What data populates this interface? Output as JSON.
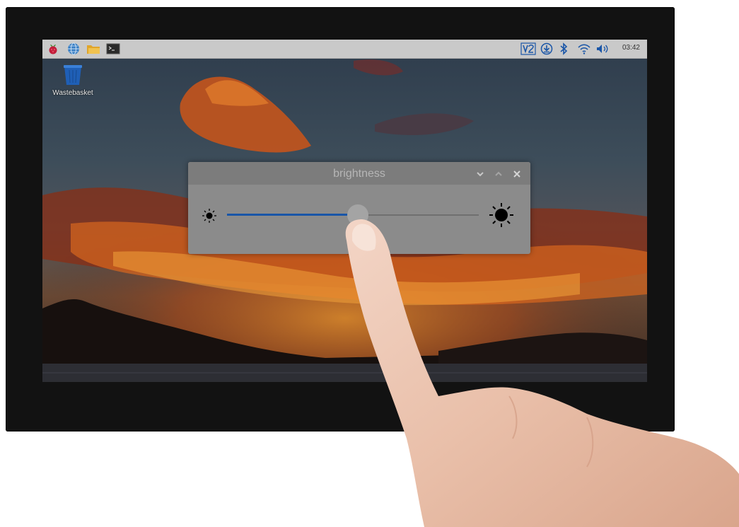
{
  "taskbar": {
    "launchers": [
      {
        "icon": "raspberry-menu-icon"
      },
      {
        "icon": "web-browser-globe-icon"
      },
      {
        "icon": "file-manager-folder-icon"
      },
      {
        "icon": "terminal-icon"
      }
    ],
    "tray": [
      {
        "icon": "vnc-icon"
      },
      {
        "icon": "download-update-icon"
      },
      {
        "icon": "bluetooth-icon"
      },
      {
        "icon": "wifi-icon"
      },
      {
        "icon": "volume-icon"
      }
    ],
    "clock": "03:42"
  },
  "desktop": {
    "icons": [
      {
        "label": "Wastebasket",
        "icon": "wastebasket-icon"
      }
    ]
  },
  "dialog": {
    "title": "brightness",
    "controls": [
      "minimize-chevron-icon",
      "maximize-chevron-icon",
      "close-icon"
    ],
    "slider": {
      "value_fraction": 0.52,
      "min_icon": "sun-small-icon",
      "max_icon": "sun-large-icon"
    }
  },
  "colors": {
    "accent": "#1a56a8",
    "taskbar": "#c9c9c9",
    "dialog_bg": "#8b8b8b",
    "dialog_title_bg": "#7c7c7c",
    "bezel": "#121212"
  }
}
